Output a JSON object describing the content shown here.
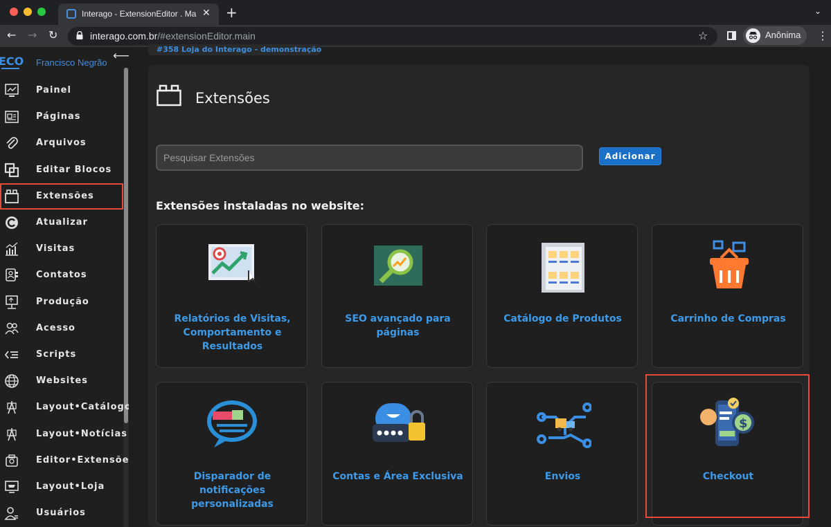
{
  "browser": {
    "tab_title": "Interago - ExtensionEditor . Ma",
    "url_host": "interago.com.br",
    "url_path": "/#extensionEditor.main",
    "profile": "Anônima"
  },
  "sidebar": {
    "user": "Francisco Negrão",
    "items": [
      {
        "label": "Painel",
        "icon": "dashboard-icon"
      },
      {
        "label": "Páginas",
        "icon": "pages-icon"
      },
      {
        "label": "Arquivos",
        "icon": "paperclip-icon"
      },
      {
        "label": "Editar Blocos",
        "icon": "blocks-icon"
      },
      {
        "label": "Extensões",
        "icon": "extensions-icon",
        "active": true
      },
      {
        "label": "Atualizar",
        "icon": "refresh-icon"
      },
      {
        "label": "Visitas",
        "icon": "chart-icon"
      },
      {
        "label": "Contatos",
        "icon": "contacts-icon"
      },
      {
        "label": "Produção",
        "icon": "production-icon"
      },
      {
        "label": "Acesso",
        "icon": "users-icon"
      },
      {
        "label": "Scripts",
        "icon": "code-icon"
      },
      {
        "label": "Websites",
        "icon": "globe-icon"
      },
      {
        "label": "Layout•Catálogo",
        "icon": "layout-icon"
      },
      {
        "label": "Layout•Notícias",
        "icon": "layout-icon"
      },
      {
        "label": "Editor•Extensões",
        "icon": "editor-icon"
      },
      {
        "label": "Layout•Loja",
        "icon": "store-icon"
      },
      {
        "label": "Usuários",
        "icon": "user-icon"
      }
    ]
  },
  "project": "#358 Loja do Interago - demonstração",
  "page": {
    "title": "Extensões",
    "search_placeholder": "Pesquisar Extensões",
    "add_label": "Adicionar",
    "section_title": "Extensões instaladas no website:"
  },
  "extensions": [
    {
      "title": "Relatórios de Visitas, Comportamento e Resultados",
      "icon": "analytics-report-icon"
    },
    {
      "title": "SEO avançado para páginas",
      "icon": "seo-magnifier-icon"
    },
    {
      "title": "Catálogo de Produtos",
      "icon": "product-catalog-icon"
    },
    {
      "title": "Carrinho de Compras",
      "icon": "shopping-basket-icon"
    },
    {
      "title": "Disparador de notificações personalizadas",
      "icon": "notification-bubble-icon"
    },
    {
      "title": "Contas e Área Exclusiva",
      "icon": "account-lock-icon"
    },
    {
      "title": "Envios",
      "icon": "delivery-truck-icon"
    },
    {
      "title": "Checkout",
      "icon": "checkout-payment-icon"
    }
  ],
  "colors": {
    "accent": "#3d9ae8",
    "highlight": "#e54a3a",
    "button": "#1a6fc7"
  }
}
